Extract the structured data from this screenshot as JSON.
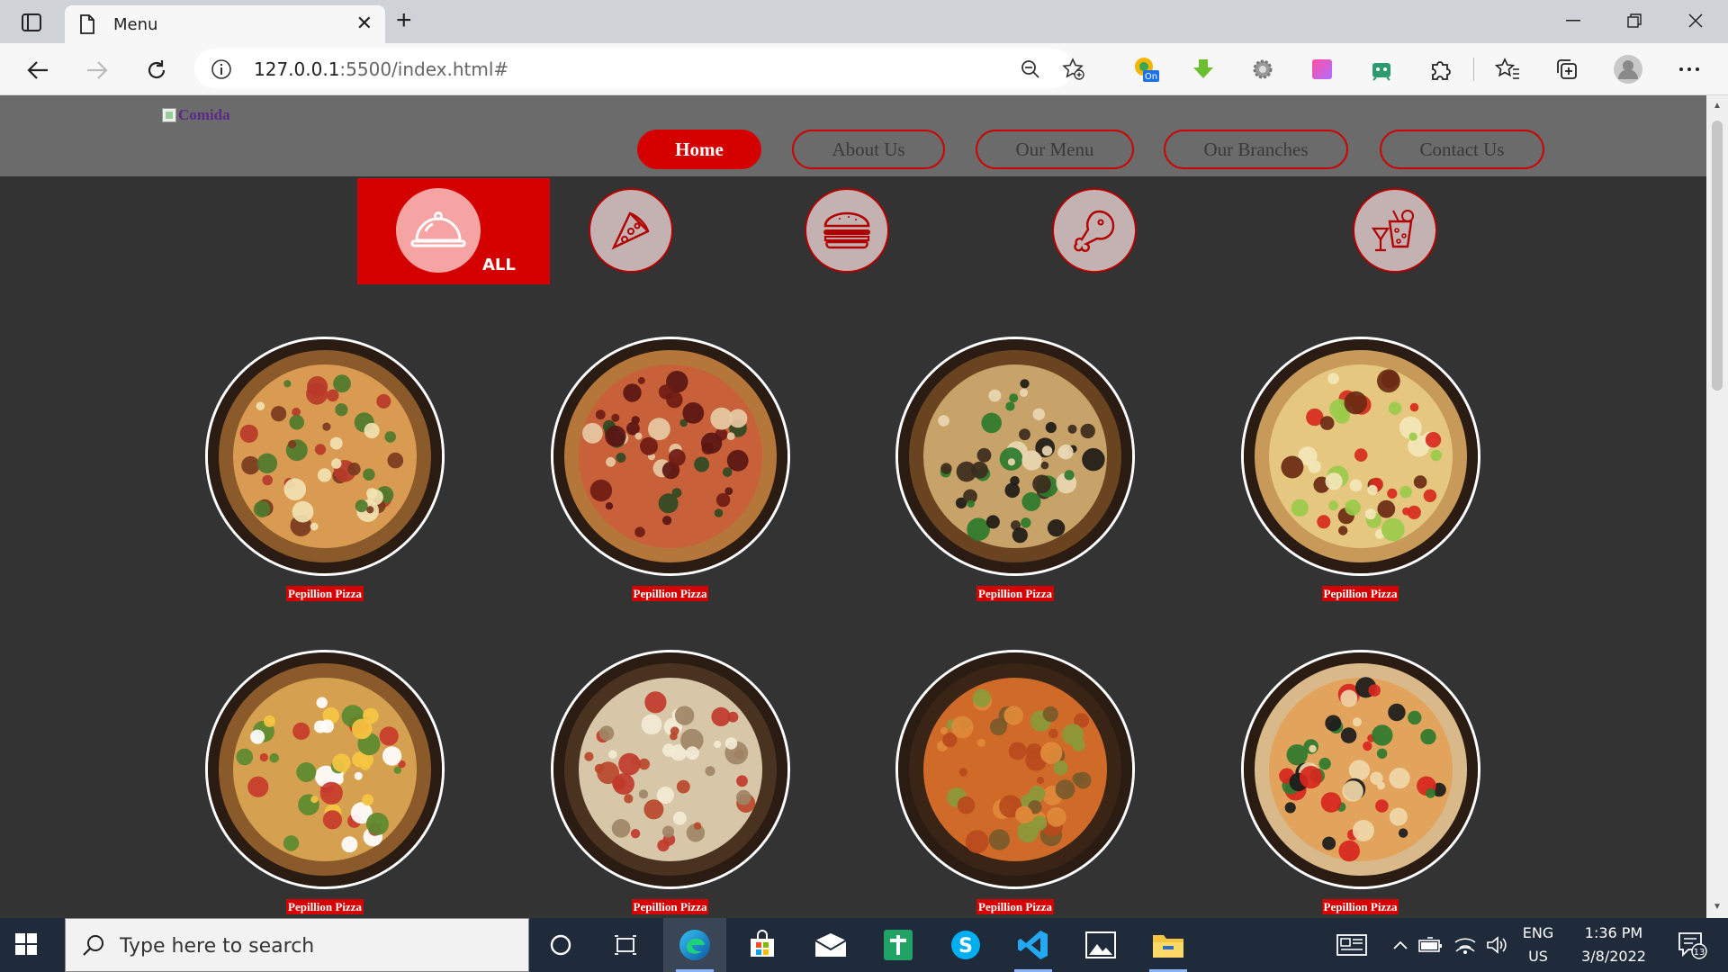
{
  "browser": {
    "tab_title": "Menu",
    "close_glyph": "✕",
    "new_tab_glyph": "+",
    "address": {
      "host": "127.0.0.1",
      "rest": ":5500/index.html#"
    },
    "extensions": [
      "coupon-on-icon",
      "download-arrow-icon",
      "gear-extension-icon",
      "gradient-extension-icon",
      "android-extension-icon",
      "puzzle-icon",
      "favorites-icon",
      "collections-icon",
      "profile-avatar",
      "more-icon"
    ],
    "extension_badge": "On"
  },
  "site": {
    "logo_alt": "Comida",
    "nav": [
      {
        "label": "Home",
        "active": true
      },
      {
        "label": "About Us",
        "active": false
      },
      {
        "label": "Our Menu",
        "active": false
      },
      {
        "label": "Our Branches",
        "active": false
      },
      {
        "label": "Contact Us",
        "active": false
      }
    ],
    "categories": [
      {
        "name": "all",
        "icon": "food-cloche-icon",
        "label": "ALL",
        "selected": true
      },
      {
        "name": "pizza",
        "icon": "pizza-slice-icon",
        "selected": false
      },
      {
        "name": "burger",
        "icon": "burger-icon",
        "selected": false
      },
      {
        "name": "chicken",
        "icon": "chicken-leg-icon",
        "selected": false
      },
      {
        "name": "drinks",
        "icon": "drinks-icon",
        "selected": false
      }
    ],
    "items": [
      {
        "label": "Pepillion Pizza",
        "style": "mixed"
      },
      {
        "label": "Pepillion Pizza",
        "style": "pepperoni"
      },
      {
        "label": "Pepillion Pizza",
        "style": "greens"
      },
      {
        "label": "Pepillion Pizza",
        "style": "tomato"
      },
      {
        "label": "Pepillion Pizza",
        "style": "egg"
      },
      {
        "label": "Pepillion Pizza",
        "style": "cheese"
      },
      {
        "label": "Pepillion Pizza",
        "style": "orange"
      },
      {
        "label": "Pepillion Pizza",
        "style": "basil"
      }
    ]
  },
  "taskbar": {
    "search_placeholder": "Type here to search",
    "apps": [
      "cortana-icon",
      "task-view-icon",
      "edge-icon",
      "store-icon",
      "mail-icon",
      "sheets-icon",
      "skype-icon",
      "vscode-icon",
      "photos-icon",
      "file-explorer-icon"
    ],
    "lang_top": "ENG",
    "lang_bottom": "US",
    "time": "1:36 PM",
    "date": "3/8/2022",
    "notification_count": "13"
  }
}
